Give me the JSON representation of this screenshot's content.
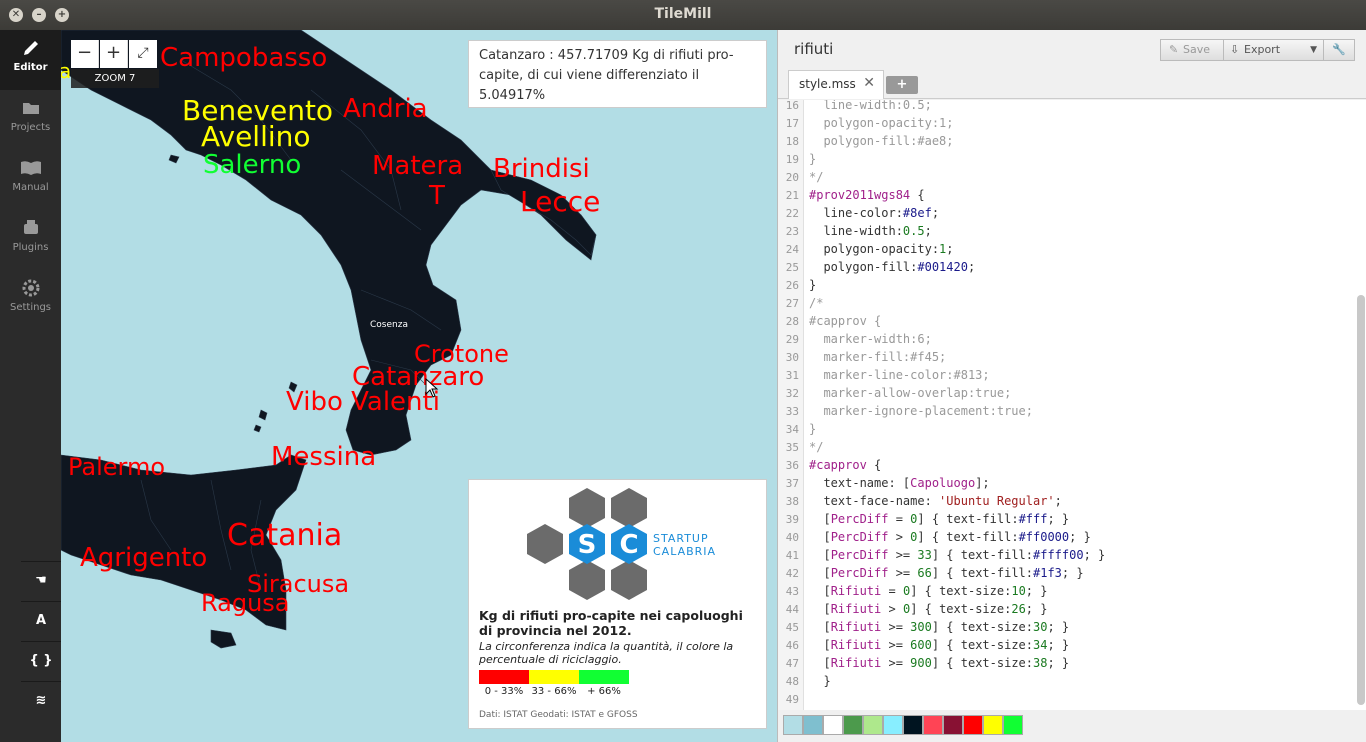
{
  "window": {
    "title": "TileMill"
  },
  "sidebar": {
    "items": [
      {
        "label": "Editor",
        "icon": "pencil-icon",
        "active": true
      },
      {
        "label": "Projects",
        "icon": "folder-icon",
        "active": false
      },
      {
        "label": "Manual",
        "icon": "book-icon",
        "active": false
      },
      {
        "label": "Plugins",
        "icon": "plugin-icon",
        "active": false
      },
      {
        "label": "Settings",
        "icon": "gear-icon",
        "active": false
      }
    ],
    "tools": [
      {
        "glyph": "☚",
        "name": "pan-tool-icon"
      },
      {
        "glyph": "A",
        "name": "font-tool-icon"
      },
      {
        "glyph": "{ }",
        "name": "carto-reference-icon"
      },
      {
        "glyph": "≋",
        "name": "layers-icon"
      }
    ]
  },
  "map": {
    "zoom": {
      "minus": "−",
      "plus": "+",
      "fullscreen": "⤢",
      "label": "ZOOM 7"
    },
    "tooltip": "Catanzaro : 457.71709 Kg di rifiuti pro-capite, di cui viene differenziato il 5.04917%",
    "labels": [
      {
        "text": "a",
        "color": "yellow"
      },
      {
        "text": "Campobasso",
        "color": "red"
      },
      {
        "text": "Benevento",
        "color": "yellow"
      },
      {
        "text": "Avellino",
        "color": "yellow"
      },
      {
        "text": "Salerno",
        "color": "green"
      },
      {
        "text": "Andria",
        "color": "red"
      },
      {
        "text": "Matera",
        "color": "red"
      },
      {
        "text": "T",
        "color": "red"
      },
      {
        "text": "Brindisi",
        "color": "red"
      },
      {
        "text": "Lecce",
        "color": "red"
      },
      {
        "text": "Cosenza",
        "color": "white"
      },
      {
        "text": "Crotone",
        "color": "red"
      },
      {
        "text": "Catanzaro",
        "color": "red"
      },
      {
        "text": "Vibo Valenti",
        "color": "red"
      },
      {
        "text": "Palermo",
        "color": "red"
      },
      {
        "text": "Messina",
        "color": "red"
      },
      {
        "text": "Catania",
        "color": "red"
      },
      {
        "text": "Agrigento",
        "color": "red"
      },
      {
        "text": "Siracusa",
        "color": "red"
      },
      {
        "text": "Ragusa",
        "color": "red"
      }
    ],
    "legend": {
      "logo_letters": [
        "S",
        "C"
      ],
      "logo_text_1": "STARTUP",
      "logo_text_2": "CALABRIA",
      "title": "Kg di rifiuti pro-capite nei capoluoghi di provincia nel 2012.",
      "subtitle": "La circonferenza indica la quantità, il colore la percentuale di riciclaggio.",
      "colors": [
        "#ff0000",
        "#ffff00",
        "#11ff33"
      ],
      "ranges": [
        "0 - 33%",
        "33 - 66%",
        "+ 66%"
      ],
      "credits": "Dati: ISTAT Geodati: ISTAT e GFOSS"
    }
  },
  "editor": {
    "project_title": "rifiuti",
    "save_label": "Save",
    "export_label": "Export",
    "tab_label": "style.mss",
    "tab_close": "✕",
    "add_tab": "+",
    "lines": [
      {
        "n": "16",
        "text": "  line-width:0.5;"
      },
      {
        "n": "17",
        "text": "  polygon-opacity:1;"
      },
      {
        "n": "18",
        "text": "  polygon-fill:#ae8;"
      },
      {
        "n": "19",
        "text": "}"
      },
      {
        "n": "20",
        "text": "*/"
      },
      {
        "n": "21",
        "text": "#prov2011wgs84 {"
      },
      {
        "n": "22",
        "text": "  line-color:#8ef;"
      },
      {
        "n": "23",
        "text": "  line-width:0.5;"
      },
      {
        "n": "24",
        "text": "  polygon-opacity:1;"
      },
      {
        "n": "25",
        "text": "  polygon-fill:#001420;"
      },
      {
        "n": "26",
        "text": "}"
      },
      {
        "n": "27",
        "text": "/*"
      },
      {
        "n": "28",
        "text": "#capprov {"
      },
      {
        "n": "29",
        "text": "  marker-width:6;"
      },
      {
        "n": "30",
        "text": "  marker-fill:#f45;"
      },
      {
        "n": "31",
        "text": "  marker-line-color:#813;"
      },
      {
        "n": "32",
        "text": "  marker-allow-overlap:true;"
      },
      {
        "n": "33",
        "text": "  marker-ignore-placement:true;"
      },
      {
        "n": "34",
        "text": "}"
      },
      {
        "n": "35",
        "text": "*/"
      },
      {
        "n": "36",
        "text": "#capprov {"
      },
      {
        "n": "37",
        "text": "  text-name: [Capoluogo];"
      },
      {
        "n": "38",
        "text": "  text-face-name: 'Ubuntu Regular';"
      },
      {
        "n": "39",
        "text": "  [PercDiff = 0] { text-fill:#fff; }"
      },
      {
        "n": "40",
        "text": "  [PercDiff > 0] { text-fill:#ff0000; }"
      },
      {
        "n": "41",
        "text": "  [PercDiff >= 33] { text-fill:#ffff00; }"
      },
      {
        "n": "42",
        "text": "  [PercDiff >= 66] { text-fill:#1f3; }"
      },
      {
        "n": "43",
        "text": "  [Rifiuti = 0] { text-size:10; }"
      },
      {
        "n": "44",
        "text": "  [Rifiuti > 0] { text-size:26; }"
      },
      {
        "n": "45",
        "text": "  [Rifiuti >= 300] { text-size:30; }"
      },
      {
        "n": "46",
        "text": "  [Rifiuti >= 600] { text-size:34; }"
      },
      {
        "n": "47",
        "text": "  [Rifiuti >= 900] { text-size:38; }"
      },
      {
        "n": "48",
        "text": "  }"
      },
      {
        "n": "49",
        "text": ""
      }
    ],
    "palette": [
      "#b2dde5",
      "#7fbfcf",
      "#ffffff",
      "#4c9a4c",
      "#aee88c",
      "#88eeff",
      "#001420",
      "#ff4455",
      "#881133",
      "#ff0000",
      "#ffff00",
      "#11ff33"
    ]
  }
}
